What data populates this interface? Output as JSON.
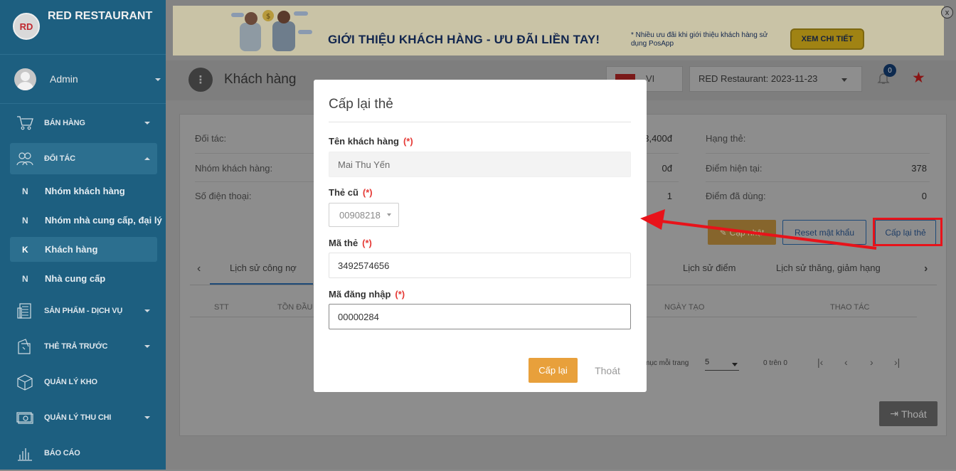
{
  "sidebar": {
    "brand": "RED RESTAURANT",
    "logo_text": "RD",
    "user": "Admin",
    "menu": [
      {
        "label": "BÁN HÀNG",
        "icon": "cart-icon"
      },
      {
        "label": "ĐỐI TÁC",
        "icon": "partners-icon"
      },
      {
        "label": "SẢN PHẨM - DỊCH VỤ",
        "icon": "register-icon"
      },
      {
        "label": "THẺ TRẢ TRƯỚC",
        "icon": "prepaid-card-icon"
      },
      {
        "label": "QUẢN LÝ KHO",
        "icon": "box-icon"
      },
      {
        "label": "QUẢN LÝ THU CHI",
        "icon": "cash-icon"
      },
      {
        "label": "BÁO CÁO",
        "icon": "report-icon"
      }
    ],
    "sub": [
      {
        "letter": "N",
        "label": "Nhóm khách hàng"
      },
      {
        "letter": "N",
        "label": "Nhóm nhà cung cấp, đại lý"
      },
      {
        "letter": "K",
        "label": "Khách hàng"
      },
      {
        "letter": "N",
        "label": "Nhà cung cấp"
      }
    ]
  },
  "banner": {
    "title": "GIỚI THIỆU KHÁCH HÀNG - ƯU ĐÃI LIỀN TAY!",
    "note": "* Nhiều ưu đãi khi giới thiệu khách hàng sử dụng PosApp",
    "button": "XEM CHI TIẾT",
    "close": "x"
  },
  "topbar": {
    "title": "Khách hàng",
    "lang": "VI",
    "branch": "RED Restaurant: 2023-11-23",
    "badge": "0"
  },
  "detail": {
    "left_labels": [
      "Đối tác:",
      "Nhóm khách hàng:",
      "Số điện thoại:"
    ],
    "mid_values": [
      "3,400đ",
      "0đ",
      "1"
    ],
    "right_labels": [
      "Hạng thẻ:",
      "Điểm hiện tại:",
      "Điểm đã dùng:"
    ],
    "right_values": [
      "",
      "378",
      "0"
    ],
    "btn_update": "Cập nhật",
    "btn_reset": "Reset mật khẩu",
    "btn_reissue": "Cấp lại thẻ"
  },
  "tabs": [
    "Lịch sử công nợ",
    "Lịch sử điểm",
    "Lịch sử thăng, giảm hạng"
  ],
  "table": {
    "headers": [
      "STT",
      "TỒN ĐẦU",
      "NGÀY TẠO",
      "THAO TÁC"
    ],
    "per_page_label": "mục mỗi trang",
    "per_page": "5",
    "range": "0 trên 0",
    "exit": "Thoát"
  },
  "modal": {
    "title": "Cấp lại thẻ",
    "req": "(*)",
    "name_label": "Tên khách hàng",
    "name_value": "Mai Thu Yến",
    "old_card_label": "Thẻ cũ",
    "old_card_value": "00908218",
    "card_code_label": "Mã thẻ",
    "card_code_value": "3492574656",
    "login_label": "Mã đăng nhập",
    "login_value": "00000284",
    "submit": "Cấp lại",
    "cancel": "Thoát"
  },
  "colors": {
    "sidebar": "#1d5f80",
    "accent": "#e8a03b",
    "annotation": "#e8131a"
  }
}
